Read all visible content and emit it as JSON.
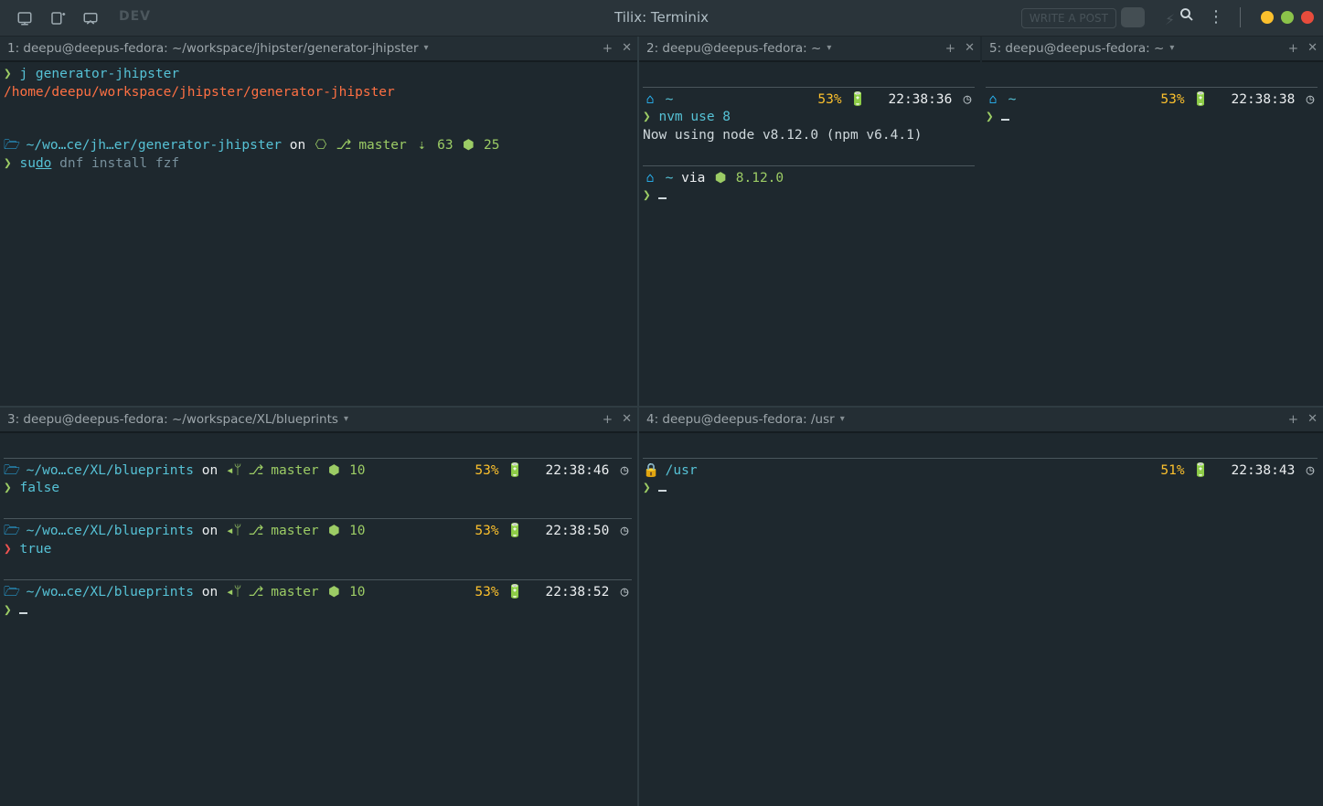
{
  "window": {
    "title": "Tilix: Terminix",
    "ghost_badge": "DEV",
    "ghost_button": "WRITE A POST"
  },
  "panes": {
    "p1": {
      "tab": {
        "label": "1: deepu@deepus-fedora: ~/workspace/jhipster/generator-jhipster"
      },
      "lines": {
        "cmd1": "j generator-jhipster",
        "path": "/home/deepu/workspace/jhipster/generator-jhipster",
        "status_path": "~/wo…ce/jh…er/generator-jhipster",
        "on": "on",
        "branch": "master",
        "behind": "63",
        "stash": "25",
        "cmd2_a": "su",
        "cmd2_b": "do",
        "cmd2_rest": " dnf install fzf"
      }
    },
    "p2": {
      "tab": {
        "label": "2: deepu@deepus-fedora: ~"
      },
      "battery": "53%",
      "time": "22:38:36",
      "cmd": "nvm use 8",
      "out": "Now using node v8.12.0 (npm v6.4.1)",
      "via": "via",
      "node": "8.12.0"
    },
    "p5": {
      "tab": {
        "label": "5: deepu@deepus-fedora: ~"
      },
      "battery": "53%",
      "time": "22:38:38"
    },
    "p3": {
      "tab": {
        "label": "3: deepu@deepus-fedora: ~/workspace/XL/blueprints"
      },
      "path": "~/wo…ce/XL/blueprints",
      "on": "on",
      "branch": "master",
      "stash": "10",
      "rows": [
        {
          "battery": "53%",
          "time": "22:38:46",
          "cmd": "false"
        },
        {
          "battery": "53%",
          "time": "22:38:50",
          "cmd": "true"
        },
        {
          "battery": "53%",
          "time": "22:38:52",
          "cmd": ""
        }
      ]
    },
    "p4": {
      "tab": {
        "label": "4: deepu@deepus-fedora: /usr"
      },
      "path": "/usr",
      "battery": "51%",
      "time": "22:38:43"
    }
  }
}
